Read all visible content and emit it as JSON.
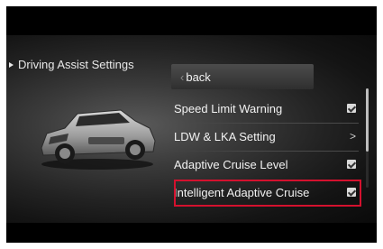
{
  "menu": {
    "title": "Driving Assist Settings",
    "items": [
      {
        "label": "back",
        "type": "back"
      },
      {
        "label": "Speed Limit Warning",
        "type": "checkbox",
        "checked": true
      },
      {
        "label": "LDW & LKA Setting",
        "type": "submenu",
        "indicator": ">"
      },
      {
        "label": "Adaptive Cruise Level",
        "type": "checkbox",
        "checked": true
      },
      {
        "label": "Intelligent Adaptive Cruise",
        "type": "checkbox",
        "checked": true,
        "highlighted": true
      }
    ]
  },
  "colors": {
    "highlight": "#d4112e",
    "text": "#f2f2f2",
    "background": "#000000"
  }
}
